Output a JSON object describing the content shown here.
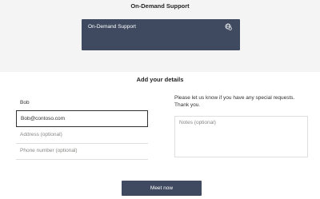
{
  "page": {
    "title": "On-Demand Support"
  },
  "service": {
    "name": "On-Demand Support",
    "icon": "globe-clock-icon"
  },
  "details": {
    "title": "Add your details",
    "name_value": "Bob",
    "email_value": "Bob@contoso.com",
    "address_placeholder": "Address (optional)",
    "phone_placeholder": "Phone number (optional)",
    "notes_label": "Please let us know if you have any special requests. Thank you.",
    "notes_placeholder": "Notes (optional)"
  },
  "actions": {
    "submit_label": "Meet now"
  },
  "colors": {
    "accent": "#3f4a60",
    "band": "#f4f4f4",
    "border": "#e1dfdd"
  }
}
